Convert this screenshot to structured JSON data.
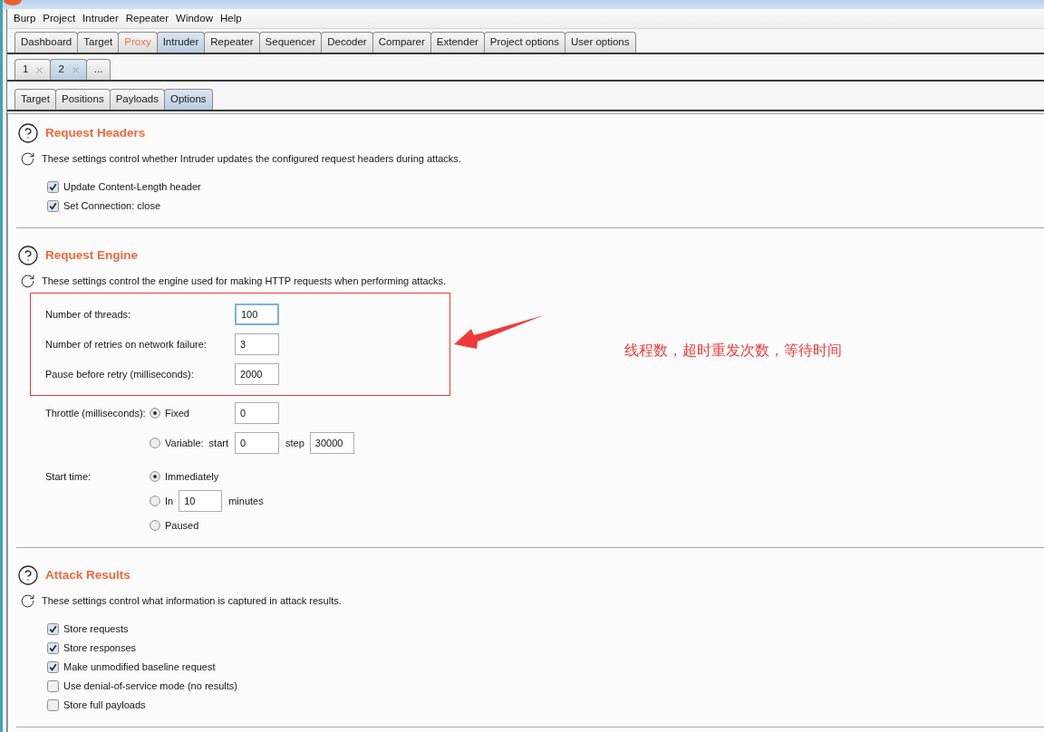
{
  "menu_bar": {
    "items": [
      "Burp",
      "Project",
      "Intruder",
      "Repeater",
      "Window",
      "Help"
    ]
  },
  "main_tabs": [
    {
      "label": "Dashboard",
      "selected": false,
      "alert": false
    },
    {
      "label": "Target",
      "selected": false,
      "alert": false
    },
    {
      "label": "Proxy",
      "selected": false,
      "alert": true
    },
    {
      "label": "Intruder",
      "selected": true,
      "alert": false
    },
    {
      "label": "Repeater",
      "selected": false,
      "alert": false
    },
    {
      "label": "Sequencer",
      "selected": false,
      "alert": false
    },
    {
      "label": "Decoder",
      "selected": false,
      "alert": false
    },
    {
      "label": "Comparer",
      "selected": false,
      "alert": false
    },
    {
      "label": "Extender",
      "selected": false,
      "alert": false
    },
    {
      "label": "Project options",
      "selected": false,
      "alert": false
    },
    {
      "label": "User options",
      "selected": false,
      "alert": false
    }
  ],
  "attack_tabs": [
    {
      "label": "1",
      "selected": false,
      "closable": true
    },
    {
      "label": "2",
      "selected": true,
      "closable": true
    },
    {
      "label": "...",
      "selected": false,
      "closable": false
    }
  ],
  "option_tabs": [
    {
      "label": "Target",
      "selected": false
    },
    {
      "label": "Positions",
      "selected": false
    },
    {
      "label": "Payloads",
      "selected": false
    },
    {
      "label": "Options",
      "selected": true
    }
  ],
  "sections": [
    {
      "kind": "checkboxes",
      "title": "Request Headers",
      "description": "These settings control whether Intruder updates the configured request headers during attacks.",
      "options": [
        {
          "label": "Update Content-Length header",
          "checked": true
        },
        {
          "label": "Set Connection: close",
          "checked": true
        }
      ]
    },
    {
      "kind": "engine",
      "title": "Request Engine",
      "description": "These settings control the engine used for making HTTP requests when performing attacks.",
      "highlighted_fields": [
        {
          "label": "Number of threads:",
          "value": "100",
          "focused": true
        },
        {
          "label": "Number of retries on network failure:",
          "value": "3",
          "focused": false
        },
        {
          "label": "Pause before retry (milliseconds):",
          "value": "2000",
          "focused": false
        }
      ],
      "throttle": {
        "label": "Throttle (milliseconds):",
        "options": [
          {
            "kind": "fixed",
            "label": "Fixed",
            "selected": true,
            "value": "0"
          },
          {
            "kind": "variable",
            "label": "Variable:",
            "selected": false,
            "start_label": "start",
            "value": "0",
            "step_label": "step",
            "step_value": "30000"
          }
        ]
      },
      "start_time": {
        "label": "Start time:",
        "options": [
          {
            "kind": "plain",
            "label": "Immediately",
            "selected": true
          },
          {
            "kind": "delay",
            "label": "In",
            "selected": false,
            "value": "10",
            "unit": "minutes"
          },
          {
            "kind": "plain",
            "label": "Paused",
            "selected": false
          }
        ]
      }
    },
    {
      "kind": "checkboxes",
      "title": "Attack Results",
      "description": "These settings control what information is captured in attack results.",
      "options": [
        {
          "label": "Store requests",
          "checked": true
        },
        {
          "label": "Store responses",
          "checked": true
        },
        {
          "label": "Make unmodified baseline request",
          "checked": true
        },
        {
          "label": "Use denial-of-service mode (no results)",
          "checked": false
        },
        {
          "label": "Store full payloads",
          "checked": false
        }
      ]
    }
  ],
  "annotation": {
    "text": "线程数，超时重发次数，等待时间"
  }
}
